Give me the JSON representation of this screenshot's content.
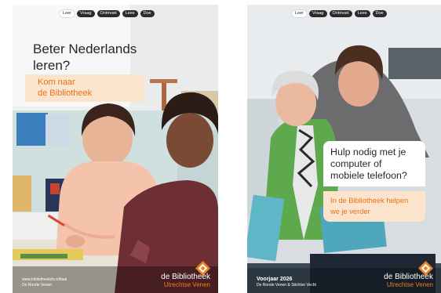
{
  "left_poster": {
    "tabs": [
      "Leer",
      "Vraag",
      "Ontmoet",
      "Lees",
      "Doe"
    ],
    "active_tab": "Leer",
    "headline_line1": "Beter Nederlands",
    "headline_line2": "leren?",
    "subhead_line1": "Kom naar",
    "subhead_line2": "de Bibliotheek",
    "footer_url": "www.bibliotheekdrv.nl/taal",
    "footer_location": "De Ronde Venen",
    "brand_name": "de Bibliotheek",
    "brand_region": "Utrechtse Venen"
  },
  "right_poster": {
    "tabs": [
      "Leer",
      "Vraag",
      "Ontmoet",
      "Lees",
      "Doe"
    ],
    "active_tab": "Leer",
    "callout_line1": "Hulp nodig met je",
    "callout_line2": "computer of",
    "callout_line3": "mobiele telefoon?",
    "callout_sub_line1": "In de Bibliotheek helpen",
    "callout_sub_line2": "we je verder",
    "footer_season": "Voorjaar 2026",
    "footer_location": "De Ronde Venen & Stichtse Vecht",
    "brand_name": "de Bibliotheek",
    "brand_region": "Utrechtse Venen"
  },
  "colors": {
    "accent_orange": "#f07e1e",
    "peach_box": "#fbe3cc",
    "tab_dark": "#2d2a2c",
    "text_dark": "#2a2627"
  },
  "icons": [
    "bibliotheek-logo-icon"
  ]
}
